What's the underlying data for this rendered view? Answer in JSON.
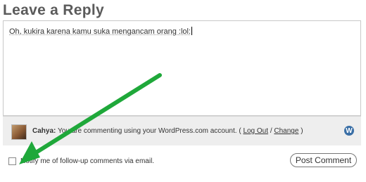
{
  "heading": "Leave a Reply",
  "comment": {
    "value": "Oh, kukira karena kamu suka mengancam orang :lol:"
  },
  "identity": {
    "username": "Cahya:",
    "message": "You are commenting using your WordPress.com account. (",
    "logout_label": "Log Out",
    "separator": "/",
    "change_label": "Change",
    "close_paren": ")"
  },
  "notify_label": "Notify me of follow-up comments via email.",
  "submit_label": "Post Comment",
  "colors": {
    "arrow": "#1fa83a",
    "wp_icon": "#3a6fa6"
  }
}
